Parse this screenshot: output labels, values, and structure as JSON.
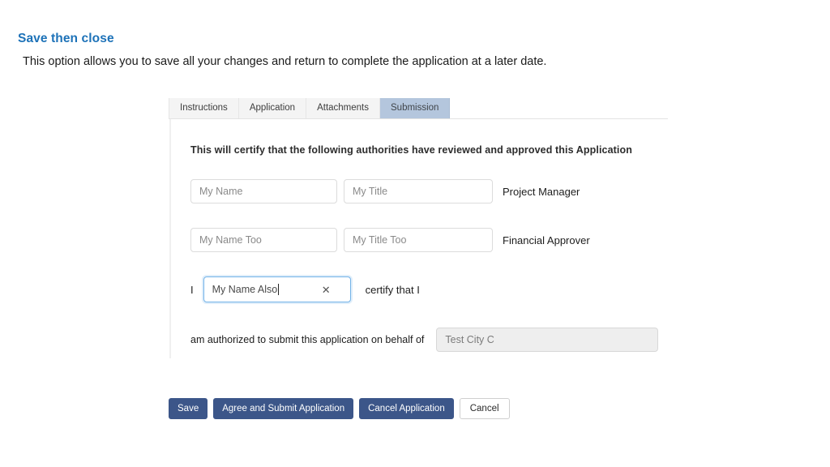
{
  "slide": {
    "title": "Save then close",
    "subtitle": "This option allows you to save all your changes and return to complete the application at a later date."
  },
  "tabs": [
    {
      "label": "Instructions",
      "active": false
    },
    {
      "label": "Application",
      "active": false
    },
    {
      "label": "Attachments",
      "active": false
    },
    {
      "label": "Submission",
      "active": true
    }
  ],
  "panel": {
    "heading": "This will certify that the following authorities have reviewed and approved this Application",
    "rows": [
      {
        "name_placeholder": "My Name",
        "title_placeholder": "My Title",
        "role": "Project Manager"
      },
      {
        "name_placeholder": "My Name Too",
        "title_placeholder": "My Title Too",
        "role": "Financial Approver"
      }
    ],
    "certify": {
      "prefix": "I",
      "input_value": "My Name Also",
      "clear_icon": "close-icon",
      "clear_glyph": "✕",
      "suffix": "certify that I"
    },
    "behalf": {
      "label": "am authorized to submit this application on behalf of",
      "org_value": "Test City C"
    }
  },
  "buttons": [
    {
      "label": "Save",
      "style": "primary"
    },
    {
      "label": "Agree and Submit Application",
      "style": "primary"
    },
    {
      "label": "Cancel Application",
      "style": "primary"
    },
    {
      "label": "Cancel",
      "style": "default"
    }
  ],
  "colors": {
    "heading_blue": "#1d72b8",
    "button_navy": "#3c5689",
    "active_tab": "#b4c6dd",
    "inactive_tab": "#f4f4f4",
    "focus_border": "#74b3e8",
    "disabled_bg": "#eeeeee"
  }
}
